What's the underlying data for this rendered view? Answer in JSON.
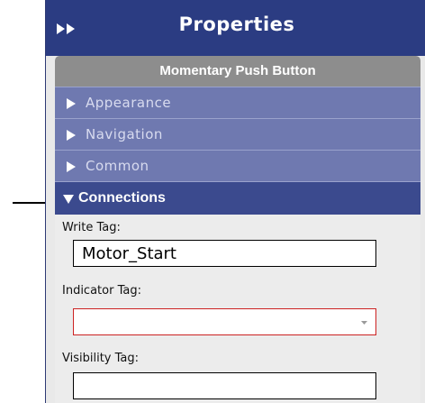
{
  "title_bar": {
    "title": "Properties",
    "collapse_icon": "double-chevron-right-icon"
  },
  "object": {
    "header": "Momentary Push Button"
  },
  "sections": [
    {
      "label": "Appearance",
      "expanded": false
    },
    {
      "label": "Navigation",
      "expanded": false
    },
    {
      "label": "Common",
      "expanded": false
    },
    {
      "label": "Connections",
      "expanded": true
    }
  ],
  "connections": {
    "write_tag": {
      "label": "Write Tag:",
      "value": "Motor_Start"
    },
    "indicator_tag": {
      "label": "Indicator Tag:",
      "value": ""
    },
    "visibility_tag": {
      "label": "Visibility Tag:",
      "value": ""
    }
  },
  "colors": {
    "title_bar": "#2b3c82",
    "object_header": "#8d8d8d",
    "section": "#6f79b0",
    "section_open": "#3b4a8e",
    "invalid_border": "#cc2222"
  }
}
